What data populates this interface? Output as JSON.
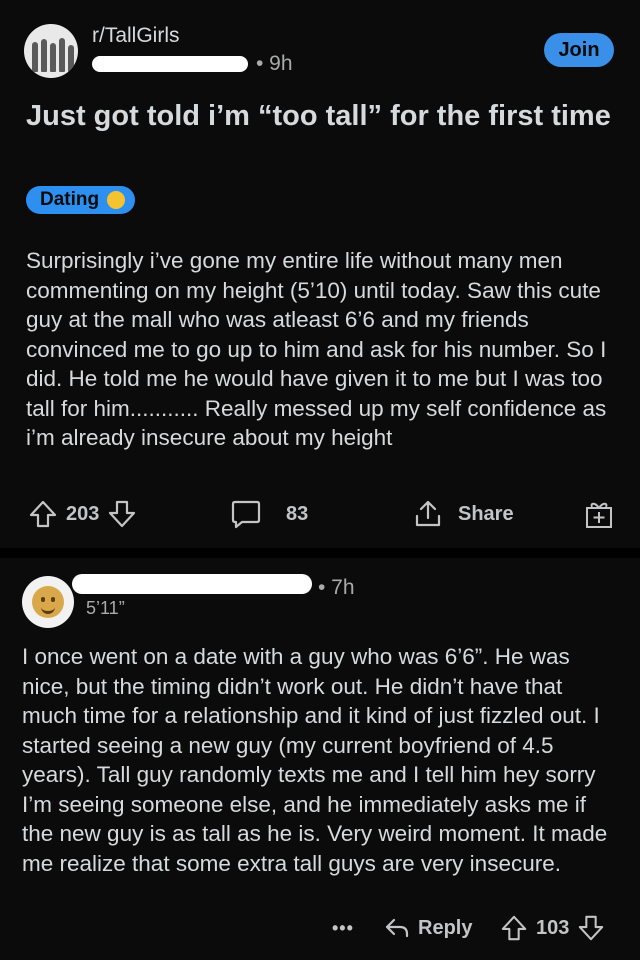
{
  "post": {
    "subreddit": "r/TallGirls",
    "time": "• 9h",
    "join_label": "Join",
    "title": "Just got told i’m “too tall” for the first time",
    "flair": "Dating",
    "body": "Surprisingly i’ve gone my entire life without many men commenting on my height (5’10) until today. Saw this cute guy at the mall who was atleast 6’6 and my friends convinced me to go up to him and ask for his number. So I did. He told me he would have given it to me but I was too tall for him........... Really messed up my self confidence as i’m already insecure about my height",
    "upvotes": "203",
    "comments": "83",
    "share_label": "Share"
  },
  "comment": {
    "time": "• 7h",
    "flair": "5’11”",
    "body": "I once went on a date with a guy who was 6’6”. He was nice, but the timing didn’t work out. He didn’t have that much time for a relationship and it kind of just fizzled out. I started seeing a new guy (my current boyfriend of 4.5 years). Tall guy randomly texts me and I tell him hey sorry I’m seeing someone else, and he immediately asks me if the new guy is as tall as he is. Very weird moment. It made me realize that some extra tall guys are very insecure.",
    "more_label": "•••",
    "reply_label": "Reply",
    "votes": "103"
  },
  "icons": {
    "upvote": "upvote-arrow-icon",
    "downvote": "downvote-arrow-icon",
    "comment": "comment-bubble-icon",
    "share": "share-icon",
    "award": "gift-award-icon",
    "reply": "reply-arrow-icon"
  },
  "colors": {
    "background": "#0b0b0b",
    "accent": "#3a8fe8",
    "text": "#d7dadc",
    "muted": "#a8aaab"
  }
}
